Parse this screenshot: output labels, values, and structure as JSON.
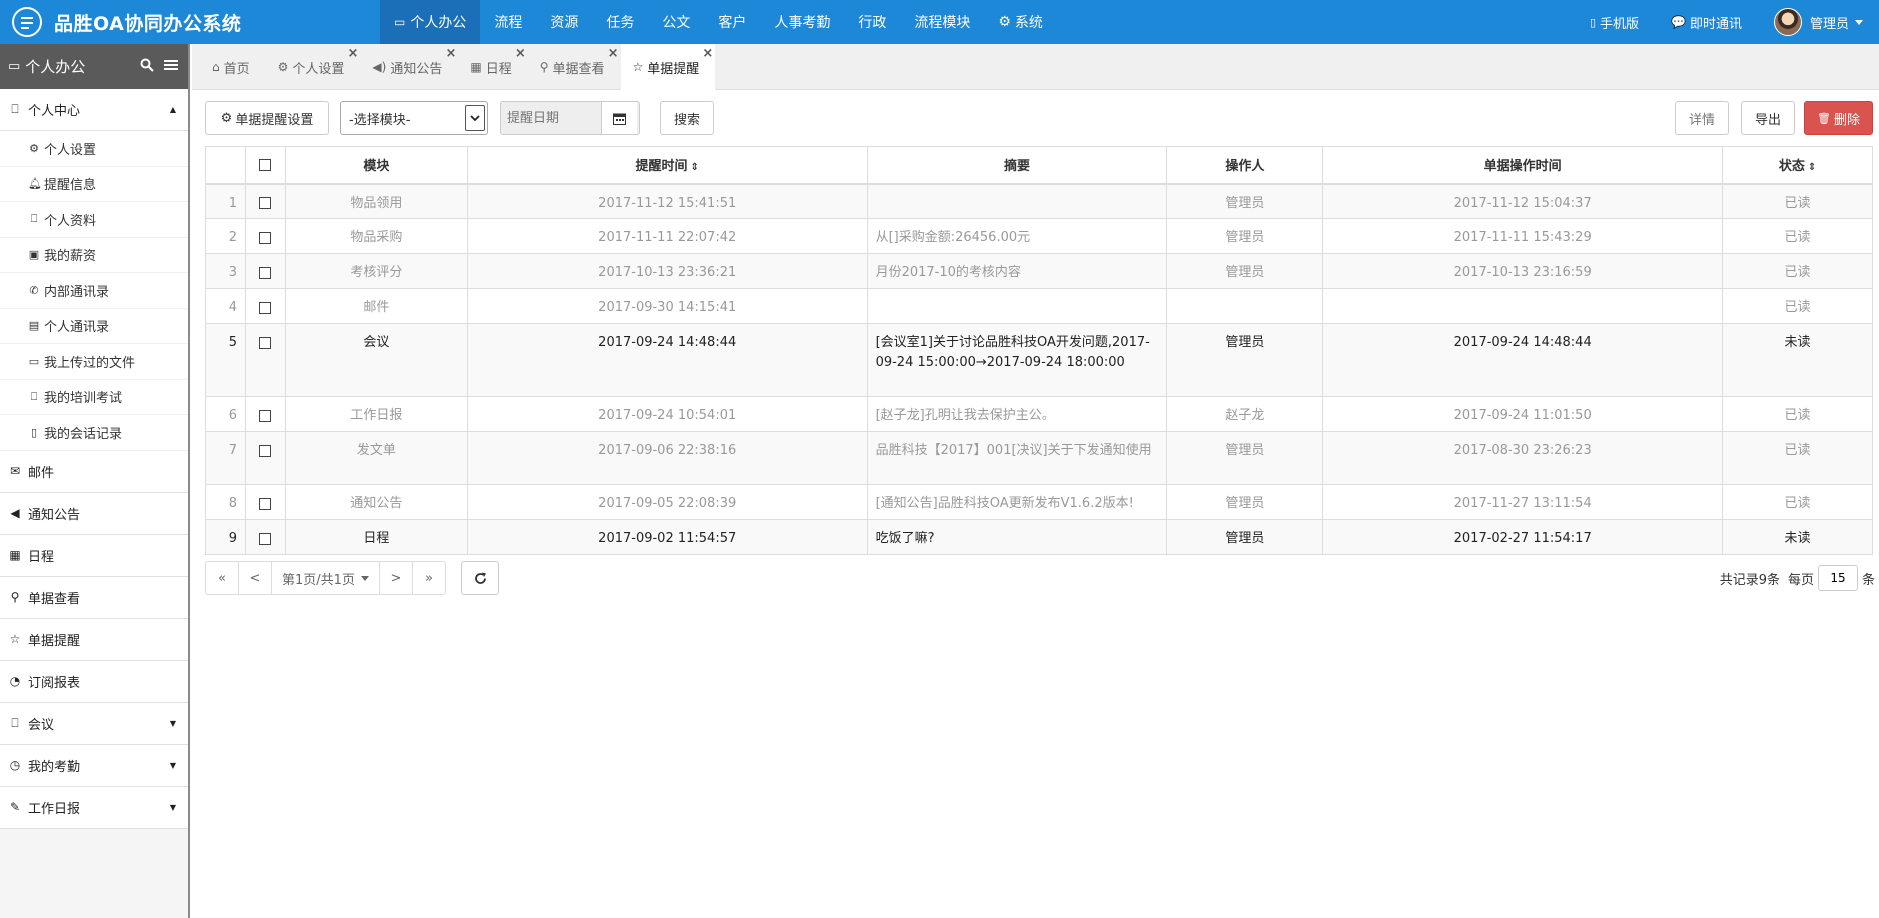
{
  "app": {
    "title": "品胜OA协同办公系统",
    "accent_color": "#1e88d8"
  },
  "topnav": {
    "items": [
      {
        "icon": "monitor-icon",
        "label": "个人办公"
      },
      {
        "label": "流程"
      },
      {
        "label": "资源"
      },
      {
        "label": "任务"
      },
      {
        "label": "公文"
      },
      {
        "label": "客户"
      },
      {
        "label": "人事考勤"
      },
      {
        "label": "行政"
      },
      {
        "label": "流程模块"
      },
      {
        "icon": "gear-icon",
        "label": "系统"
      }
    ],
    "mobile_label": "手机版",
    "im_label": "即时通讯",
    "user_label": "管理员"
  },
  "sidebar": {
    "header": "个人办公",
    "group_personal": "个人中心",
    "subitems": [
      {
        "icon": "gear-icon",
        "label": "个人设置"
      },
      {
        "icon": "bell-icon",
        "label": "提醒信息"
      },
      {
        "icon": "bookmark-icon",
        "label": "个人资料"
      },
      {
        "icon": "money-icon",
        "label": "我的薪资"
      },
      {
        "icon": "phone-icon",
        "label": "内部通讯录"
      },
      {
        "icon": "card-icon",
        "label": "个人通讯录"
      },
      {
        "icon": "folder-icon",
        "label": "我上传过的文件"
      },
      {
        "icon": "bookmark-icon",
        "label": "我的培训考试"
      },
      {
        "icon": "file-icon",
        "label": "我的会话记录"
      }
    ],
    "groups": [
      {
        "icon": "envelope-icon",
        "label": "邮件",
        "caret": false
      },
      {
        "icon": "volume-icon",
        "label": "通知公告",
        "caret": false
      },
      {
        "icon": "calendar-icon",
        "label": "日程",
        "caret": false
      },
      {
        "icon": "search-icon",
        "label": "单据查看",
        "caret": false
      },
      {
        "icon": "star-icon",
        "label": "单据提醒",
        "caret": false
      },
      {
        "icon": "rss-icon",
        "label": "订阅报表",
        "caret": false
      },
      {
        "icon": "bookmark-icon",
        "label": "会议",
        "caret": true
      },
      {
        "icon": "clock-icon",
        "label": "我的考勤",
        "caret": true
      },
      {
        "icon": "edit-icon",
        "label": "工作日报",
        "caret": true
      }
    ]
  },
  "tabs": [
    {
      "icon": "home-icon",
      "label": "首页",
      "closable": false,
      "active": false
    },
    {
      "icon": "gear-icon",
      "label": "个人设置",
      "closable": true,
      "active": false
    },
    {
      "icon": "volume-icon",
      "label": "通知公告",
      "closable": true,
      "active": false
    },
    {
      "icon": "calendar-icon",
      "label": "日程",
      "closable": true,
      "active": false
    },
    {
      "icon": "search-icon",
      "label": "单据查看",
      "closable": true,
      "active": false
    },
    {
      "icon": "star-icon",
      "label": "单据提醒",
      "closable": true,
      "active": true
    }
  ],
  "toolbar": {
    "settings_label": "单据提醒设置",
    "module_select_value": "-选择模块-",
    "date_placeholder": "提醒日期",
    "search_label": "搜索",
    "detail_label": "详情",
    "export_label": "导出",
    "delete_label": "删除"
  },
  "table": {
    "headers": {
      "module": "模块",
      "remind_time": "提醒时间",
      "summary": "摘要",
      "operator": "操作人",
      "op_time": "单据操作时间",
      "status": "状态"
    },
    "rows": [
      {
        "num": "1",
        "module": "物品领用",
        "remind_time": "2017-11-12 15:41:51",
        "summary": "",
        "operator": "管理员",
        "op_time": "2017-11-12 15:04:37",
        "status": "已读",
        "unread": false
      },
      {
        "num": "2",
        "module": "物品采购",
        "remind_time": "2017-11-11 22:07:42",
        "summary": "从[]采购金额:26456.00元",
        "operator": "管理员",
        "op_time": "2017-11-11 15:43:29",
        "status": "已读",
        "unread": false
      },
      {
        "num": "3",
        "module": "考核评分",
        "remind_time": "2017-10-13 23:36:21",
        "summary": "月份2017-10的考核内容",
        "operator": "管理员",
        "op_time": "2017-10-13 23:16:59",
        "status": "已读",
        "unread": false
      },
      {
        "num": "4",
        "module": "邮件",
        "remind_time": "2017-09-30 14:15:41",
        "summary": "",
        "operator": "",
        "op_time": "",
        "status": "已读",
        "unread": false
      },
      {
        "num": "5",
        "module": "会议",
        "remind_time": "2017-09-24 14:48:44",
        "summary": "[会议室1]关于讨论品胜科技OA开发问题,2017-09-24 15:00:00→2017-09-24 18:00:00",
        "operator": "管理员",
        "op_time": "2017-09-24 14:48:44",
        "status": "未读",
        "unread": true
      },
      {
        "num": "6",
        "module": "工作日报",
        "remind_time": "2017-09-24 10:54:01",
        "summary": "[赵子龙]孔明让我去保护主公。",
        "operator": "赵子龙",
        "op_time": "2017-09-24 11:01:50",
        "status": "已读",
        "unread": false
      },
      {
        "num": "7",
        "module": "发文单",
        "remind_time": "2017-09-06 22:38:16",
        "summary": "品胜科技【2017】001[决议]关于下发通知使用",
        "operator": "管理员",
        "op_time": "2017-08-30 23:26:23",
        "status": "已读",
        "unread": false
      },
      {
        "num": "8",
        "module": "通知公告",
        "remind_time": "2017-09-05 22:08:39",
        "summary": "[通知公告]品胜科技OA更新发布V1.6.2版本!",
        "operator": "管理员",
        "op_time": "2017-11-27 13:11:54",
        "status": "已读",
        "unread": false
      },
      {
        "num": "9",
        "module": "日程",
        "remind_time": "2017-09-02 11:54:57",
        "summary": "吃饭了嘛?",
        "operator": "管理员",
        "op_time": "2017-02-27 11:54:17",
        "status": "未读",
        "unread": true
      }
    ]
  },
  "pager": {
    "first": "«",
    "prev": "<",
    "page_label": "第1页/共1页",
    "next": ">",
    "last": "»",
    "total_label": "共记录9条",
    "per_page_prefix": "每页",
    "per_page_value": "15",
    "per_page_suffix": "条"
  }
}
